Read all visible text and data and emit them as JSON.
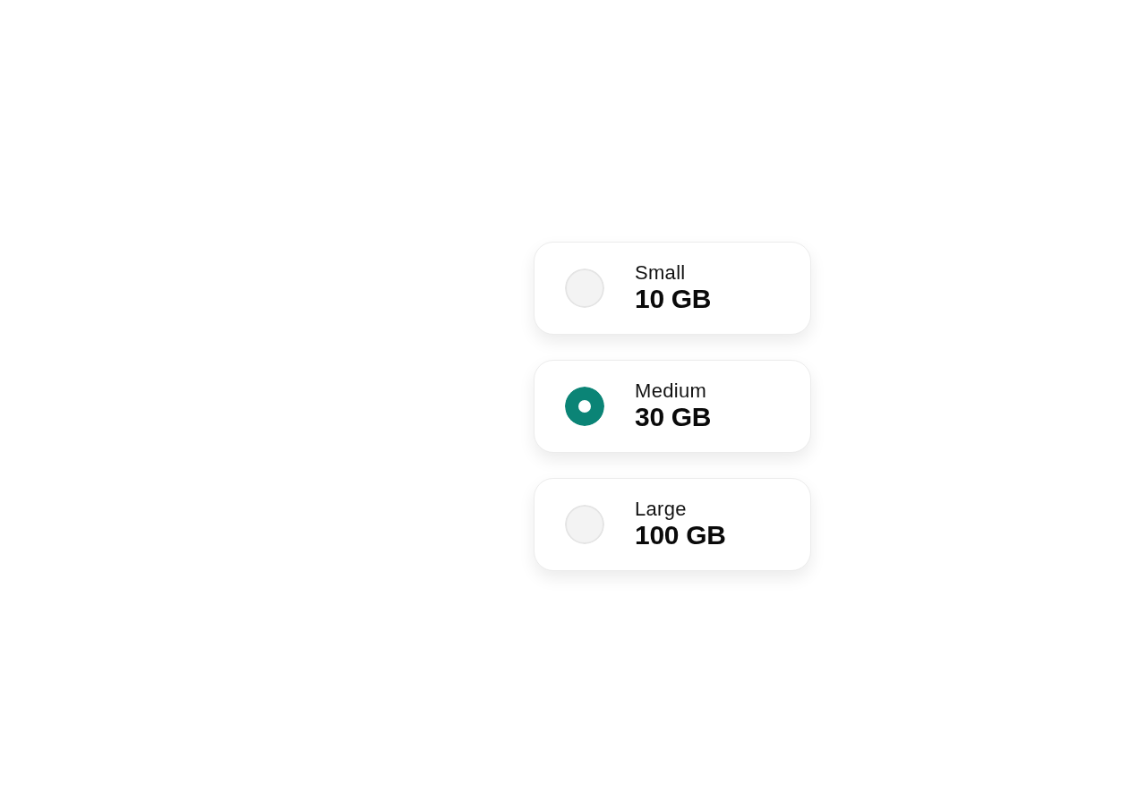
{
  "options": [
    {
      "label": "Small",
      "size": "10 GB",
      "selected": false
    },
    {
      "label": "Medium",
      "size": "30 GB",
      "selected": true
    },
    {
      "label": "Large",
      "size": "100 GB",
      "selected": false
    }
  ]
}
